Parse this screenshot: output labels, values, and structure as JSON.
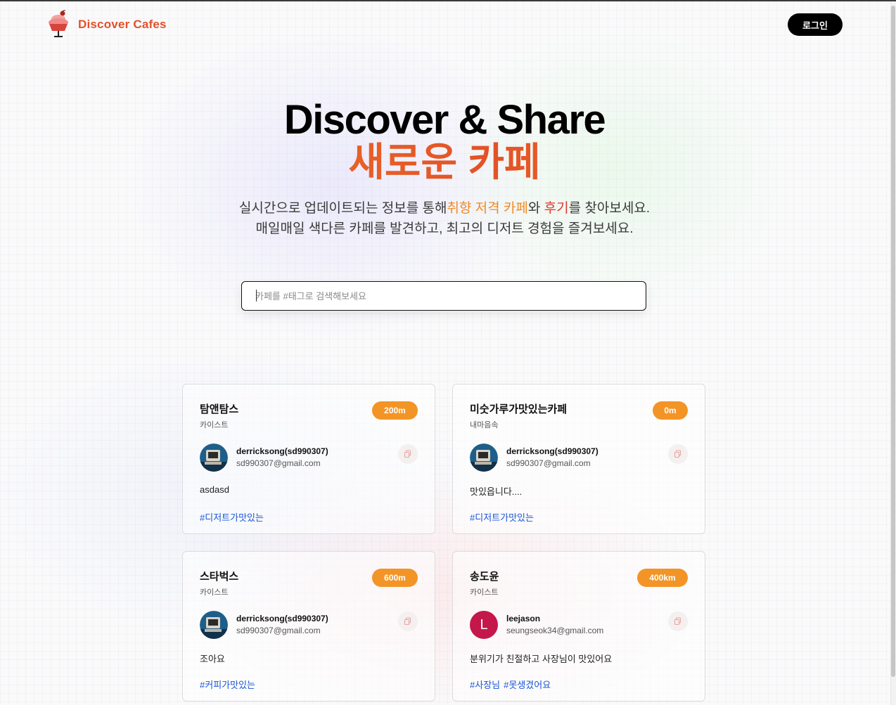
{
  "brand": {
    "name": "Discover Cafes",
    "icon": "cupcake-icon"
  },
  "header": {
    "login_label": "로그인"
  },
  "hero": {
    "title": "Discover & Share",
    "subtitle": "새로운 카페",
    "desc_line1_a": "실시간으로 업데이트되는 정보를 통해",
    "desc_line1_hl1": "취향 저격 카페",
    "desc_line1_b": "와 ",
    "desc_line1_hl2": "후기",
    "desc_line1_c": "를 찾아보세요.",
    "desc_line2": "매일매일 색다른 카페를 발견하고, 최고의 디저트 경험을 즐겨보세요."
  },
  "search": {
    "placeholder": "카페를 #태그로 검색해보세요",
    "value": ""
  },
  "cards": [
    {
      "title": "탐앤탐스",
      "place": "카이스트",
      "distance": "200m",
      "user_name": "derricksong(sd990307)",
      "user_email": "sd990307@gmail.com",
      "avatar": "retro-computer-avatar",
      "review": "asdasd",
      "tags": [
        "#디저트가맛있는"
      ]
    },
    {
      "title": "미숫가루가맛있는카페",
      "place": "내마음속",
      "distance": "0m",
      "user_name": "derricksong(sd990307)",
      "user_email": "sd990307@gmail.com",
      "avatar": "retro-computer-avatar",
      "review": "맛있읍니다....",
      "tags": [
        "#디저트가맛있는"
      ]
    },
    {
      "title": "스타벅스",
      "place": "카이스트",
      "distance": "600m",
      "user_name": "derricksong(sd990307)",
      "user_email": "sd990307@gmail.com",
      "avatar": "retro-computer-avatar",
      "review": "조아요",
      "tags": [
        "#커피가맛있는"
      ]
    },
    {
      "title": "송도윤",
      "place": "카이스트",
      "distance": "400km",
      "user_name": "leejason",
      "user_email": "seungseok34@gmail.com",
      "avatar_letter": "L",
      "review": "분위기가 친절하고 사장님이 맛있어요",
      "tags": [
        "#사장님",
        "#못생겼어요"
      ]
    }
  ],
  "colors": {
    "brand": "#e4502a",
    "badge": "#f39426",
    "tag": "#1a56d6",
    "avatar_letter_bg": "#c4174a",
    "highlight_orange": "#f08a24",
    "highlight_red": "#e0372a"
  }
}
